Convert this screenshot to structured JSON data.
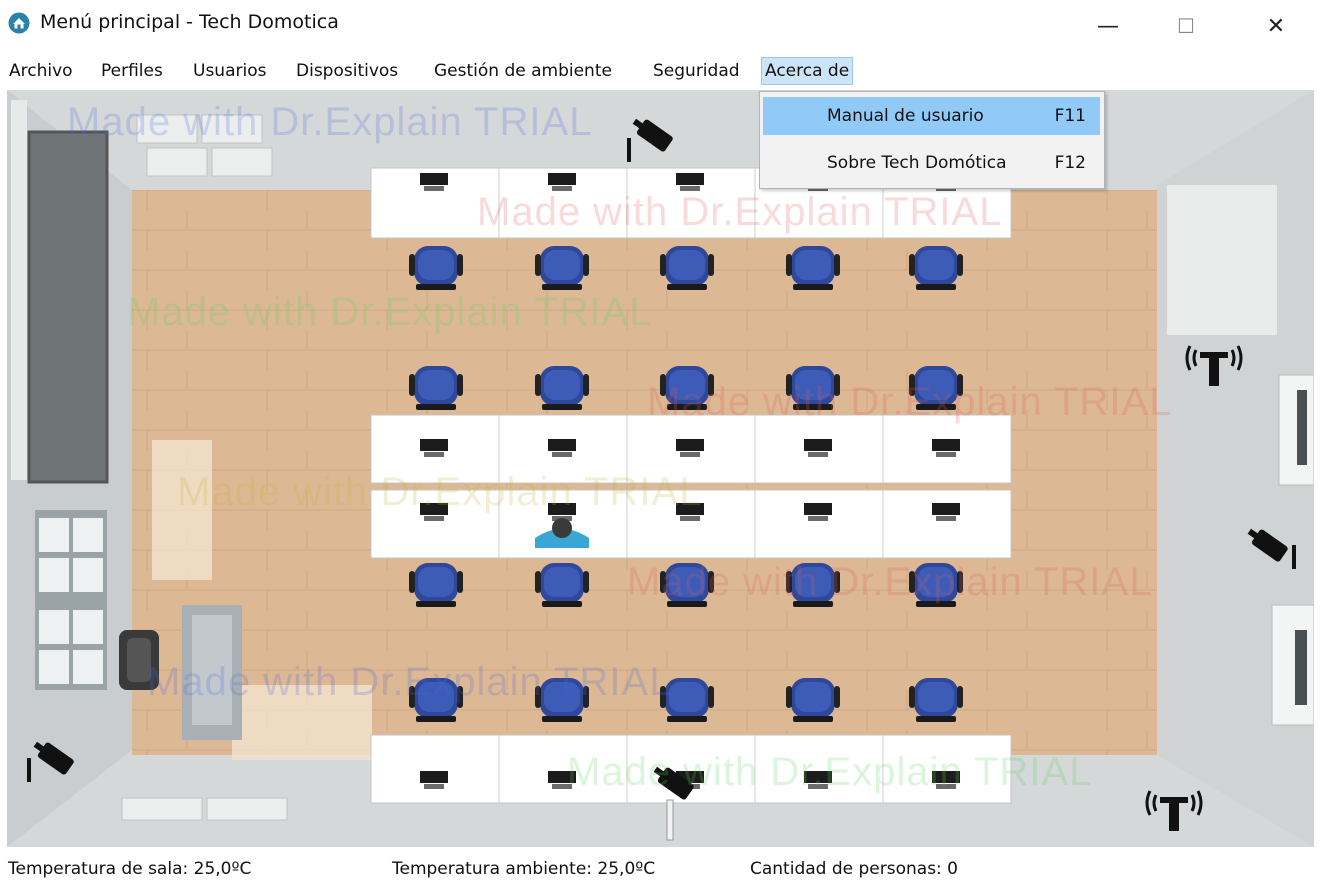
{
  "window": {
    "title": "Menú principal - Tech Domotica",
    "icon": "home-app-icon",
    "controls": {
      "minimize": "—",
      "maximize": "☐",
      "close": "✕"
    }
  },
  "menubar": {
    "items": [
      "Archivo",
      "Perfiles",
      "Usuarios",
      "Dispositivos",
      "Gestión de ambiente",
      "Seguridad",
      "Acerca de"
    ],
    "active": "Acerca de"
  },
  "dropdown": {
    "items": [
      {
        "label": "Manual de usuario",
        "shortcut": "F11"
      },
      {
        "label": "Sobre Tech Domótica",
        "shortcut": "F12"
      }
    ],
    "highlighted": "Manual de usuario"
  },
  "status": {
    "room_temp": "Temperatura de sala: 25,0ºC",
    "ambient_temp": "Temperatura ambiente: 25,0ºC",
    "people_count": "Cantidad de personas: 0"
  },
  "watermark": "Made with Dr.Explain TRIAL",
  "room_icons": [
    "security-camera-icon",
    "wifi-antenna-icon",
    "air-conditioner-icon",
    "person-icon",
    "laptop-icon",
    "chair-icon"
  ],
  "colors": {
    "floor": "#d9b592",
    "desk": "#ffffff",
    "chair": "#2f4a9c",
    "wall": "#d7dbdc",
    "menu_highlight": "#91c9f7"
  }
}
